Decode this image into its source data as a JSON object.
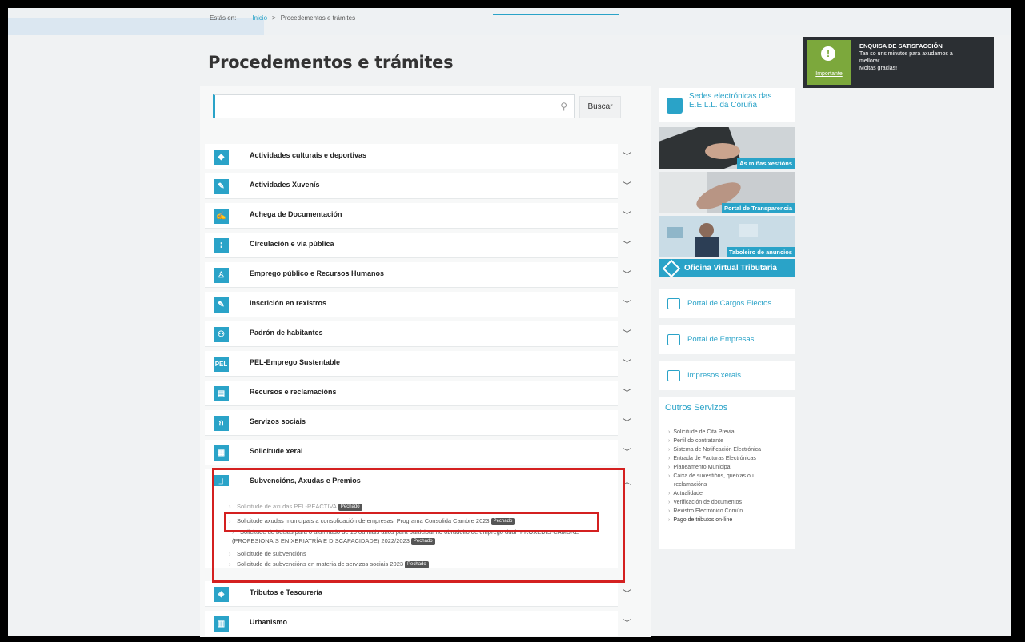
{
  "breadcrumb": {
    "prefix": "Estás en:",
    "home": "Inicio",
    "sep": ">",
    "current": "Procedementos e trámites"
  },
  "page_title": "Procedementos e trámites",
  "search": {
    "placeholder": "",
    "button": "Buscar"
  },
  "categories": [
    {
      "label": "Actividades culturais e deportivas",
      "icon": "diamond-icon",
      "glyph": "◆"
    },
    {
      "label": "Actividades Xuvenís",
      "icon": "palette-icon",
      "glyph": "✎"
    },
    {
      "label": "Achega de Documentación",
      "icon": "pen-icon",
      "glyph": "✍"
    },
    {
      "label": "Circulación e vía pública",
      "icon": "traffic-light-icon",
      "glyph": "⁝"
    },
    {
      "label": "Emprego público e Recursos Humanos",
      "icon": "person-icon",
      "glyph": "♙"
    },
    {
      "label": "Inscrición en rexistros",
      "icon": "edit-icon",
      "glyph": "✎"
    },
    {
      "label": "Padrón de habitantes",
      "icon": "people-icon",
      "glyph": "⚇"
    },
    {
      "label": "PEL-Emprego Sustentable",
      "icon": "pel-icon",
      "glyph": "PEL"
    },
    {
      "label": "Recursos e reclamacións",
      "icon": "document-icon",
      "glyph": "▤"
    },
    {
      "label": "Servizos sociais",
      "icon": "hand-icon",
      "glyph": "ก"
    },
    {
      "label": "Solicitude xeral",
      "icon": "form-icon",
      "glyph": "▦"
    },
    {
      "label": "Subvencións, Axudas e Premios",
      "icon": "chart-icon",
      "glyph": "⅃"
    },
    {
      "label": "Tributos e Tesourería",
      "icon": "tax-icon",
      "glyph": "◈"
    },
    {
      "label": "Urbanismo",
      "icon": "building-icon",
      "glyph": "▥"
    }
  ],
  "expanded_items": [
    {
      "text": "Solicitude de axudas PEL-REACTIVA",
      "badge": "Pechado"
    },
    {
      "text": "Solicitude axudas municipais a consolidación de empresas. Programa Consolida Cambre 2023",
      "badge": "Pechado"
    },
    {
      "text": "Solicitude de bolsas para o alumnado de 16 ou máis anos para participar no obradoiro de emprego dual \"PROXEDIS-CAMBRE\" (PROFESIONAIS EN XERIATRÍA E DISCAPACIDADE) 2022/2023",
      "badge": "Pechado"
    },
    {
      "text": "Solicitude de subvencións",
      "badge": ""
    },
    {
      "text": "Solicitude de subvencións en materia de servizos sociais 2023",
      "badge": "Pechado"
    }
  ],
  "sidebar": {
    "sedes": "Sedes electrónicas das E.E.L.L. da Coruña",
    "banners": [
      "As miñas xestións",
      "Portal de Transparencia",
      "Taboleiro de anuncios"
    ],
    "ovt": "Oficina Virtual Tributaria",
    "links": [
      "Portal de Cargos Electos",
      "Portal de Empresas",
      "Impresos xerais"
    ],
    "outros_title": "Outros Servizos",
    "outros": [
      "Solicitude de Cita Previa",
      "Perfil do contratante",
      "Sistema de Notificación Electrónica",
      "Entrada de Facturas Electrónicas",
      "Planeamento Municipal",
      "Caixa de suxestións, queixas ou",
      "reclamacións",
      "Actualidade",
      "Verificación de documentos",
      "Rexistro Electrónico Común",
      "Pago de tributos on-line"
    ]
  },
  "notice": {
    "tag": "Importante",
    "title": "ENQUISA DE SATISFACCIÓN",
    "line1": "Tan so uns minutos para axudarnos a",
    "line2": "mellorar.",
    "line3": "Moitas gracias!"
  },
  "colors": {
    "accent": "#2aa3c8",
    "highlight": "#d42020",
    "notice_bg": "#2b2f33",
    "notice_green": "#7ca83c"
  }
}
